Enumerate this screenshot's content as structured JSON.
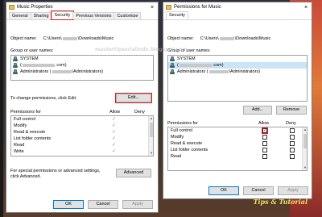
{
  "left": {
    "title": "Music Properties",
    "close": "×",
    "tabs": [
      "General",
      "Sharing",
      "Security",
      "Previous Versions",
      "Customize"
    ],
    "object_name_label": "Object name:",
    "object_name_prefix": "C:\\Users\\",
    "object_name_suffix": "\\Downloads\\Music",
    "group_label": "Group or user names:",
    "users": [
      {
        "name": "SYSTEM",
        "suffix": ""
      },
      {
        "name": "(",
        "suffix": ".com)"
      },
      {
        "name": "Administrators (",
        "suffix": "\\Administrators)"
      }
    ],
    "change_text": "To change permissions, click Edit.",
    "edit_button": "Edit...",
    "perm_for": "Permissions for",
    "allow": "Allow",
    "deny": "Deny",
    "perms": [
      "Full control",
      "Modify",
      "Read & execute",
      "List folder contents",
      "Read",
      "Write"
    ],
    "allow_checks": [
      true,
      true,
      true,
      true,
      true,
      true
    ],
    "special_text_1": "For special permissions or advanced settings,",
    "special_text_2": "click Advanced.",
    "advanced_button": "Advanced",
    "ok": "OK",
    "cancel": "Cancel",
    "apply": "Apply"
  },
  "right": {
    "title": "Permissions for Music",
    "close": "×",
    "tab": "Security",
    "object_name_label": "Object name:",
    "object_name_prefix": "C:\\Users\\",
    "object_name_suffix": "\\Downloads\\Music",
    "group_label": "Group or user names:",
    "users": [
      {
        "name": "SYSTEM",
        "suffix": ""
      },
      {
        "name": "(",
        "suffix": ".com)"
      },
      {
        "name": "Administrators (",
        "suffix": "\\Administrators)"
      }
    ],
    "add_button": "Add...",
    "remove_button": "Remove",
    "perm_for": "Permissions for",
    "allow": "Allow",
    "deny": "Deny",
    "perms": [
      "Full control",
      "Modify",
      "Read & execute",
      "List folder contents",
      "Read"
    ],
    "allow_checks": [
      true,
      false,
      false,
      false,
      false
    ],
    "ok": "OK",
    "cancel": "Cancel",
    "apply": "Apply"
  },
  "watermark": "mastertipsorialindo.blogspot.com",
  "brand": "Tips & Tutorial"
}
